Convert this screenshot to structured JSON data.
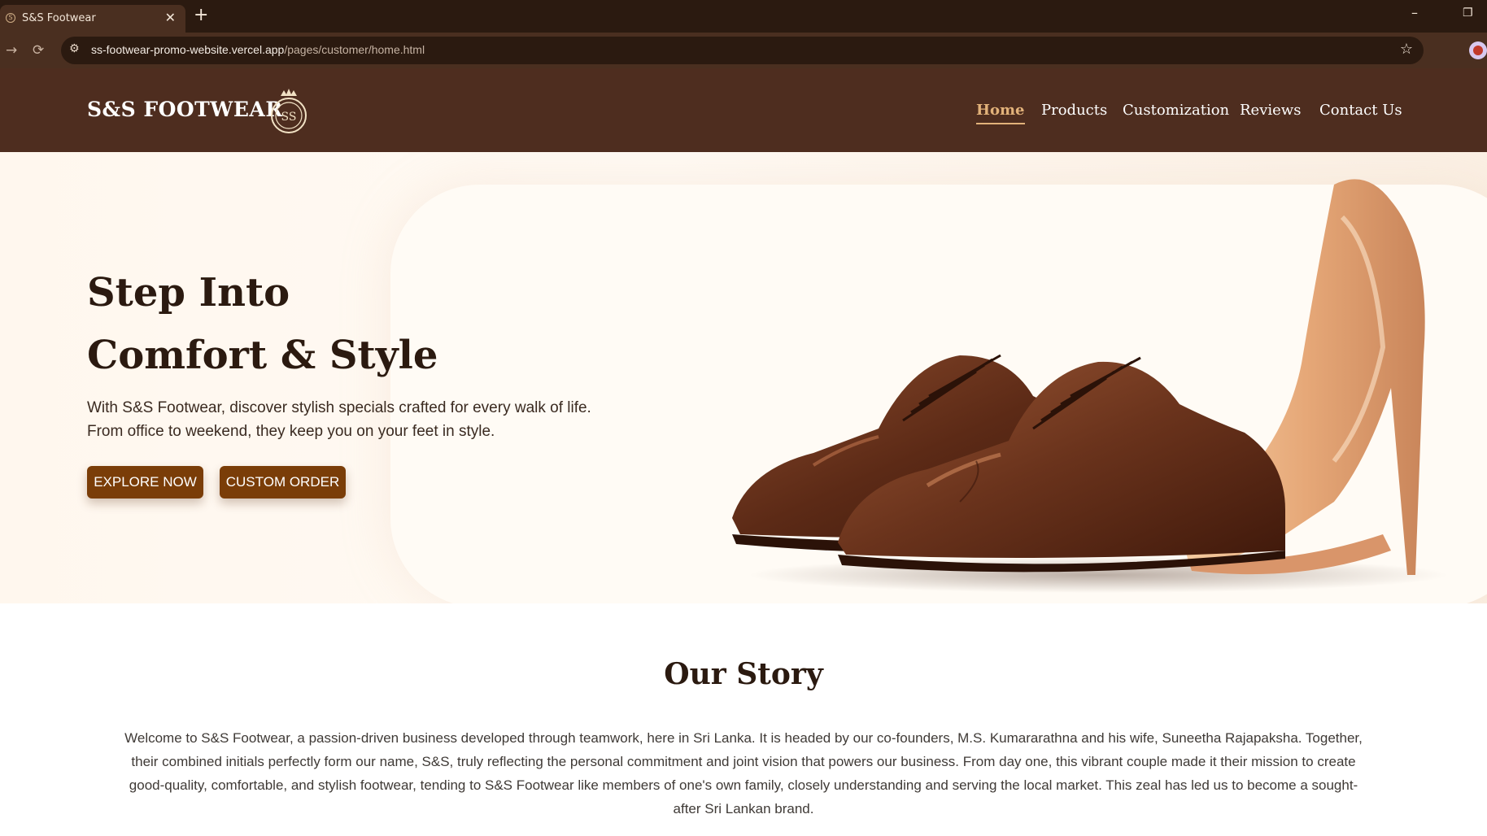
{
  "browser": {
    "tab_title": "S&S Footwear",
    "tab_close": "✕",
    "new_tab": "+",
    "minimize": "–",
    "restore": "❐",
    "url_host": "ss-footwear-promo-website.vercel.app",
    "url_path": "/pages/customer/home.html",
    "icons": [
      "forward-icon",
      "reload-icon",
      "site-settings-icon",
      "bookmark-star-icon",
      "profile-avatar"
    ]
  },
  "header": {
    "brand": "S&S FOOTWEAR",
    "logo_text": "SS",
    "nav": [
      {
        "label": "Home",
        "active": true
      },
      {
        "label": "Products",
        "active": false
      },
      {
        "label": "Customization",
        "active": false
      },
      {
        "label": "Reviews",
        "active": false
      },
      {
        "label": "Contact Us",
        "active": false
      }
    ]
  },
  "hero": {
    "title_line1": "Step Into",
    "title_line2": "Comfort & Style",
    "subtitle_line1": "With S&S Footwear, discover stylish specials crafted for every walk of life.",
    "subtitle_line2": "From office to weekend, they keep you on your feet in style.",
    "explore_label": "EXPLORE NOW",
    "custom_label": "CUSTOM ORDER"
  },
  "story": {
    "title": "Our Story",
    "lines": [
      "Welcome to S&S Footwear, a passion-driven business developed through teamwork, here in Sri Lanka. It is headed by our co-founders, M.S. Kumararathna and his wife, Suneetha Rajapaksha. Together,",
      "their combined initials perfectly form our name, S&S, truly reflecting the personal commitment and joint vision that powers our business. From day one, this vibrant couple made it their mission to create",
      "good-quality, comfortable, and stylish footwear, tending to S&S Footwear like members of one's own family, closely understanding and serving the local market. This zeal has led us to become a sought-",
      "after Sri Lankan brand."
    ]
  },
  "colors": {
    "header_bg": "#4e2d1f",
    "accent": "#e2b27a",
    "button_bg": "#7a3d08",
    "hero_bg": "#fff7ee"
  }
}
